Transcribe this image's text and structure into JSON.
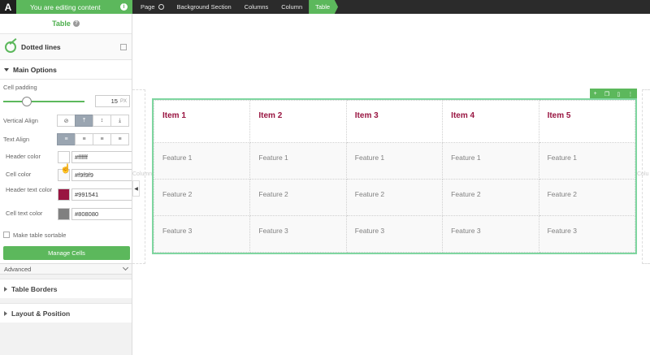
{
  "topbar": {
    "logo": "A",
    "editing_label": "You are editing content",
    "info_icon": "i",
    "breadcrumbs": [
      "Page",
      "Background Section",
      "Columns",
      "Column",
      "Table"
    ]
  },
  "panel": {
    "title": "Table",
    "help_icon": "?",
    "preset_label": "Dotted lines",
    "main_options": "Main Options",
    "cell_padding": {
      "label": "Cell padding",
      "value": "15",
      "unit": "PX",
      "slider_fraction": 0.25
    },
    "vertical_align": {
      "label": "Vertical Align",
      "selected": 1
    },
    "text_align": {
      "label": "Text Align",
      "selected": 0
    },
    "colors": [
      {
        "label": "Header color",
        "value": "#ffffff",
        "swatch": "#ffffff"
      },
      {
        "label": "Cell color",
        "value": "#f9f9f9",
        "swatch": "#f9f9f9"
      },
      {
        "label": "Header text color",
        "value": "#991541",
        "swatch": "#991541"
      },
      {
        "label": "Cell text color",
        "value": "#808080",
        "swatch": "#808080"
      }
    ],
    "sortable_label": "Make table sortable",
    "manage_button": "Manage Cells",
    "advanced_label": "Advanced",
    "sections": [
      "Table Borders",
      "Layout & Position"
    ]
  },
  "table": {
    "headers": [
      "Item 1",
      "Item 2",
      "Item 3",
      "Item 4",
      "Item 5"
    ],
    "rows": [
      [
        "Feature 1",
        "Feature 1",
        "Feature 1",
        "Feature 1",
        "Feature 1"
      ],
      [
        "Feature 2",
        "Feature 2",
        "Feature 2",
        "Feature 2",
        "Feature 2"
      ],
      [
        "Feature 3",
        "Feature 3",
        "Feature 3",
        "Feature 3",
        "Feature 3"
      ]
    ]
  },
  "ghost_labels": {
    "left": "Column",
    "right": "Colu"
  }
}
